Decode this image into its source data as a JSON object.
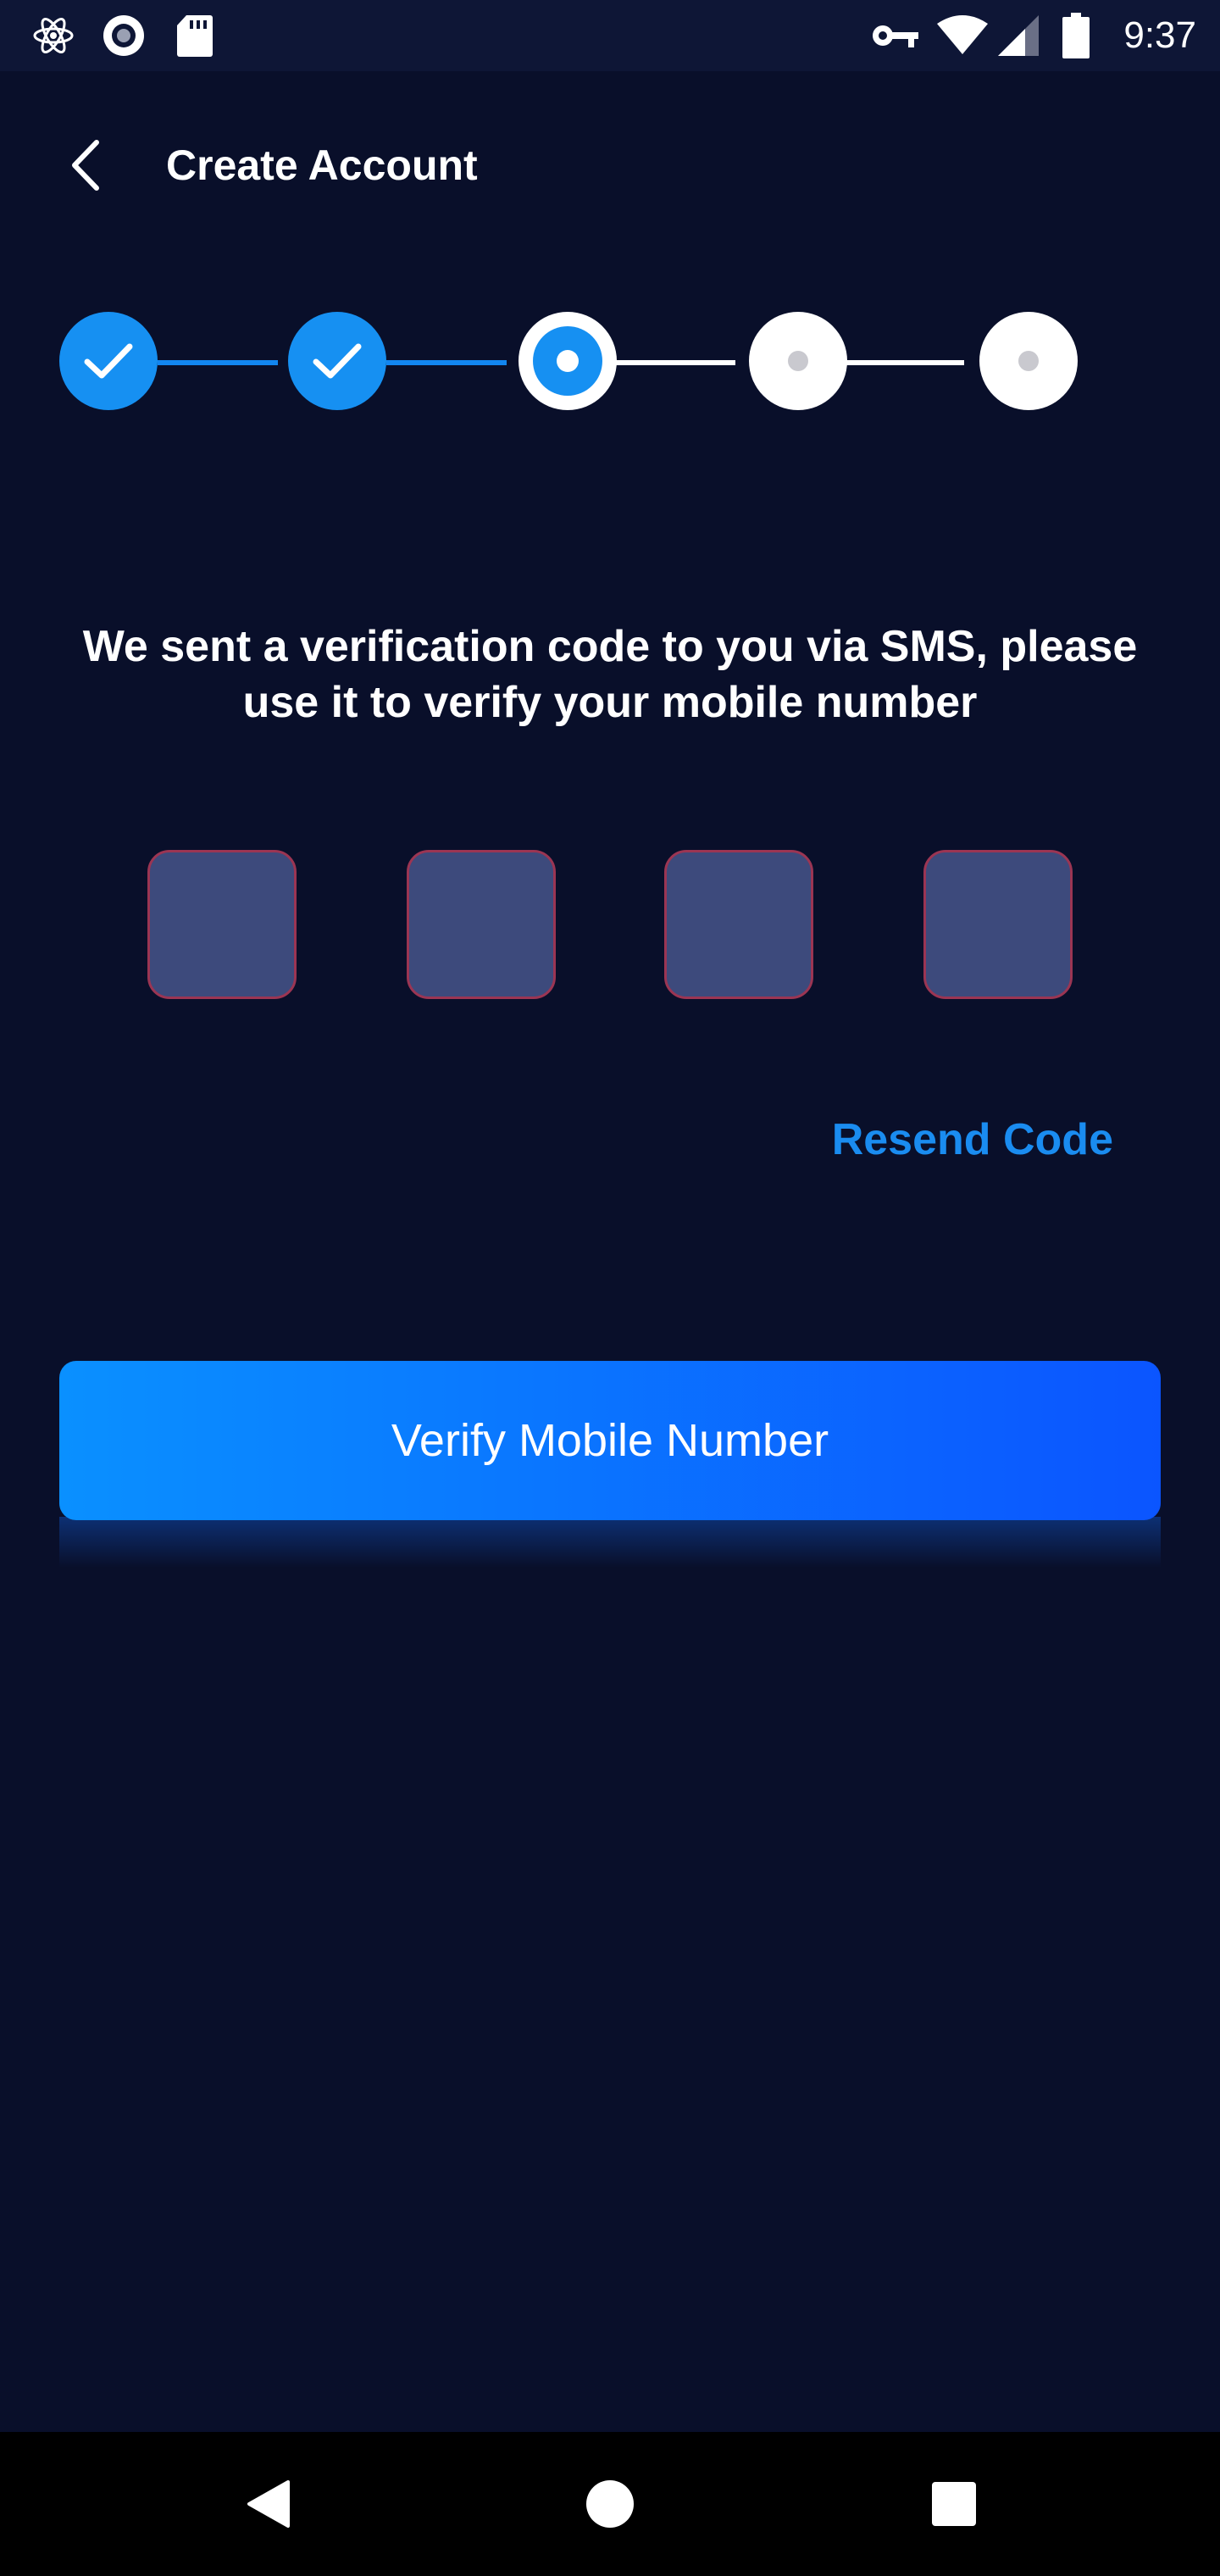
{
  "status_bar": {
    "time": "9:37",
    "left_icons": [
      "atom-icon",
      "record-icon",
      "sd-card-icon"
    ],
    "right_icons": [
      "key-icon",
      "wifi-icon",
      "signal-icon",
      "battery-icon"
    ]
  },
  "header": {
    "title": "Create Account",
    "back_icon": "chevron-left-icon"
  },
  "stepper": {
    "total_steps": 5,
    "current_step": 3,
    "steps": [
      "done",
      "done",
      "current",
      "todo",
      "todo"
    ]
  },
  "instruction": "We sent a verification code to you via SMS, please use it to verify your mobile number",
  "code_inputs": [
    {
      "value": "",
      "placeholder": ""
    },
    {
      "value": "",
      "placeholder": ""
    },
    {
      "value": "",
      "placeholder": ""
    },
    {
      "value": "",
      "placeholder": ""
    }
  ],
  "resend_label": "Resend Code",
  "verify_label": "Verify Mobile Number",
  "nav_bar": {
    "icons": [
      "back-triangle-icon",
      "home-circle-icon",
      "recents-square-icon"
    ]
  },
  "colors": {
    "background": "#090f2a",
    "accent": "#1690f2",
    "button_start": "#0a90ff",
    "button_end": "#0b55ff",
    "code_box_fill": "#3d4a7c",
    "code_box_border": "#9b3553",
    "link": "#1a8cf0"
  }
}
